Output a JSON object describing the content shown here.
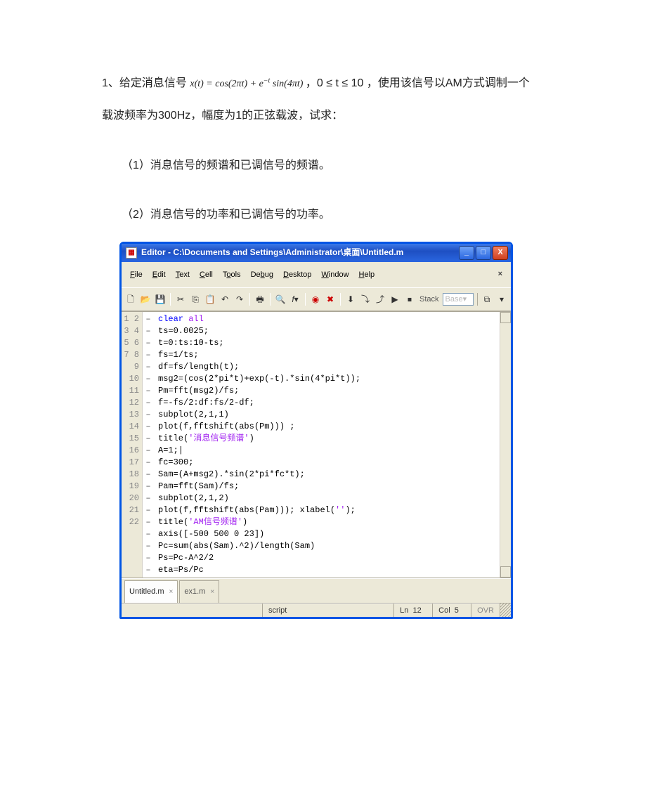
{
  "doc": {
    "line1a": "1、给定消息信号",
    "formula1": "x(t) = cos(2πt) + e",
    "formula1_exp": "−t",
    "formula1b": " sin(4πt)",
    "line1b": " ，0 ≤ t ≤ 10 ，使用该信号以AM方式调制一个",
    "line2": "载波频率为300Hz，幅度为1的正弦载波，试求：",
    "q1": "（1）消息信号的频谱和已调信号的频谱。",
    "q2": "（2）消息信号的功率和已调信号的功率。"
  },
  "window": {
    "title": "Editor - C:\\Documents and Settings\\Administrator\\桌面\\Untitled.m",
    "minimize": "_",
    "maximize": "□",
    "close": "X"
  },
  "menu": {
    "items": [
      "File",
      "Edit",
      "Text",
      "Cell",
      "Tools",
      "Debug",
      "Desktop",
      "Window",
      "Help"
    ]
  },
  "toolbar": {
    "stack_label": "Stack",
    "stack_value": "Base"
  },
  "tabs": {
    "active": "Untitled.m",
    "other": "ex1.m"
  },
  "statusbar": {
    "script": "script",
    "ln_label": "Ln",
    "ln": "12",
    "col_label": "Col",
    "col": "5",
    "ovr": "OVR"
  },
  "code": [
    {
      "n": "1",
      "kw": "clear",
      "kw2": "all",
      "rest": ""
    },
    {
      "n": "2",
      "txt": "ts=0.0025;"
    },
    {
      "n": "3",
      "txt": "t=0:ts:10-ts;"
    },
    {
      "n": "4",
      "txt": "fs=1/ts;"
    },
    {
      "n": "5",
      "txt": "df=fs/length(t);"
    },
    {
      "n": "6",
      "txt": "msg2=(cos(2*pi*t)+exp(-t).*sin(4*pi*t));"
    },
    {
      "n": "7",
      "txt": "Pm=fft(msg2)/fs;"
    },
    {
      "n": "8",
      "txt": "f=-fs/2:df:fs/2-df;"
    },
    {
      "n": "9",
      "txt": "subplot(2,1,1)"
    },
    {
      "n": "10",
      "txt": "plot(f,fftshift(abs(Pm))) ;"
    },
    {
      "n": "11",
      "pre": "title(",
      "str": "'消息信号频谱'",
      "post": ")"
    },
    {
      "n": "12",
      "txt": "A=1;|"
    },
    {
      "n": "13",
      "txt": "fc=300;"
    },
    {
      "n": "14",
      "txt": "Sam=(A+msg2).*sin(2*pi*fc*t);"
    },
    {
      "n": "15",
      "txt": "Pam=fft(Sam)/fs;"
    },
    {
      "n": "16",
      "txt": "subplot(2,1,2)"
    },
    {
      "n": "17",
      "pre": "plot(f,fftshift(abs(Pam))); xlabel(",
      "str": "''",
      "post": ");"
    },
    {
      "n": "18",
      "pre": "title(",
      "str": "'AM信号频谱'",
      "post": ")"
    },
    {
      "n": "19",
      "txt": "axis([-500 500 0 23])"
    },
    {
      "n": "20",
      "txt": "Pc=sum(abs(Sam).^2)/length(Sam)"
    },
    {
      "n": "21",
      "txt": "Ps=Pc-A^2/2"
    },
    {
      "n": "22",
      "txt": "eta=Ps/Pc"
    }
  ]
}
